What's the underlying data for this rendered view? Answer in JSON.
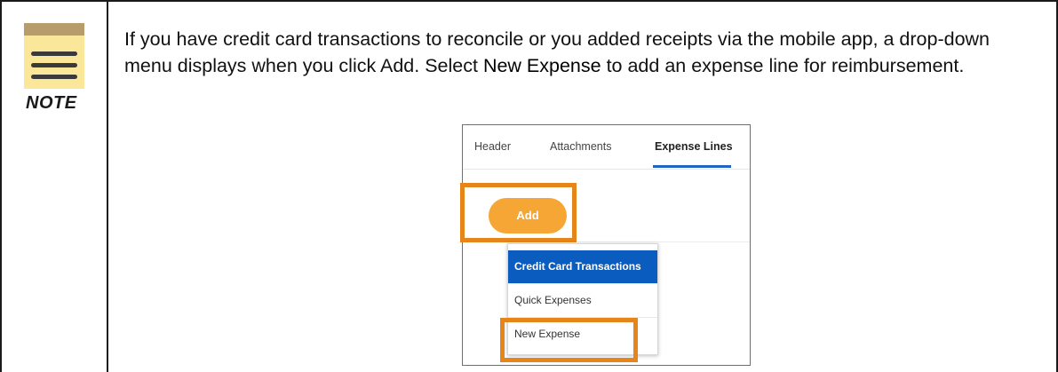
{
  "note": {
    "icon_label": "NOTE",
    "text_before": "If you have credit card transactions to reconcile or you added receipts via the mobile app, a drop-down menu displays when you click Add. Select ",
    "text_bold": "New Expense",
    "text_after": " to add an expense line for reimbursement."
  },
  "screenshot": {
    "tabs": [
      "Header",
      "Attachments",
      "Expense Lines"
    ],
    "active_tab": "Expense Lines",
    "add_button": "Add",
    "dropdown_items": [
      "Credit Card Transactions",
      "Quick Expenses",
      "New Expense"
    ],
    "selected_item": "Credit Card Transactions",
    "highlighted": [
      "Add",
      "New Expense"
    ]
  },
  "colors": {
    "accent_orange": "#e5851a",
    "button_orange": "#f6a634",
    "selection_blue": "#0b5cbf",
    "tab_underline": "#1f66c2",
    "note_yellow": "#fbe79a",
    "note_cap": "#b79d6c"
  }
}
